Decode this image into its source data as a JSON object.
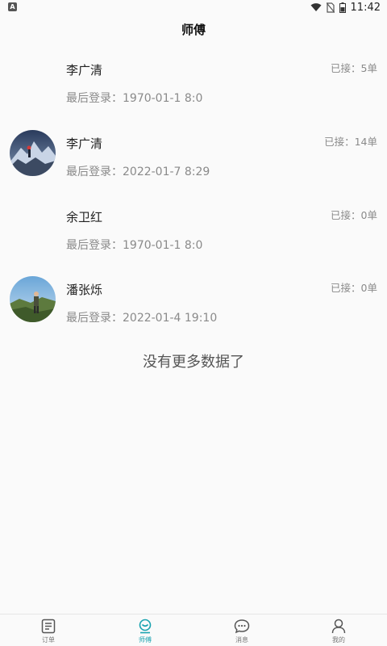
{
  "status_bar": {
    "time": "11:42"
  },
  "header": {
    "title": "师傅"
  },
  "masters": [
    {
      "name": "李广清",
      "last_login_label": "最后登录：",
      "last_login": "1970-01-1 8:0",
      "taken": "已接：5单",
      "has_avatar": false
    },
    {
      "name": "李广清",
      "last_login_label": "最后登录：",
      "last_login": "2022-01-7 8:29",
      "taken": "已接：14单",
      "has_avatar": true
    },
    {
      "name": "余卫红",
      "last_login_label": "最后登录：",
      "last_login": "1970-01-1 8:0",
      "taken": "已接：0单",
      "has_avatar": false
    },
    {
      "name": "潘张烁",
      "last_login_label": "最后登录：",
      "last_login": "2022-01-4 19:10",
      "taken": "已接：0单",
      "has_avatar": true
    }
  ],
  "list_footer": "没有更多数据了",
  "tabs": [
    {
      "label": "订单",
      "icon": "order-list-icon",
      "active": false
    },
    {
      "label": "师傅",
      "icon": "master-icon",
      "active": true
    },
    {
      "label": "消息",
      "icon": "message-icon",
      "active": false
    },
    {
      "label": "我的",
      "icon": "profile-icon",
      "active": false
    }
  ],
  "colors": {
    "accent": "#1aa3b0",
    "text_primary": "#222222",
    "text_secondary": "#8a8a8a",
    "background": "#fafafa"
  }
}
